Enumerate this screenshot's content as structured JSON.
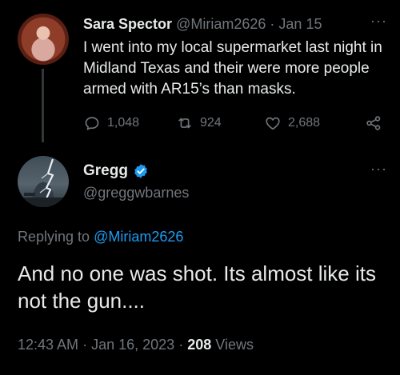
{
  "parent_tweet": {
    "name": "Sara Spector",
    "handle": "@Miriam2626",
    "separator": "·",
    "date": "Jan 15",
    "more": "···",
    "text": "I went into my local supermarket last night in Midland Texas and their were more people armed with AR15’s than masks.",
    "replies": "1,048",
    "retweets": "924",
    "likes": "2,688"
  },
  "main_tweet": {
    "name": "Gregg",
    "handle": "@greggwbarnes",
    "more": "···",
    "replying_prefix": "Replying to",
    "replying_mention": "@Miriam2626",
    "text": "And no one was shot. Its almost like its not the gun....",
    "time": "12:43 AM",
    "date": "Jan 16, 2023",
    "views_count": "208",
    "views_label": "Views"
  },
  "colors": {
    "background": "#000000",
    "text_primary": "#e7e9ea",
    "text_secondary": "#71767b",
    "accent": "#1d9bf0",
    "thread_line": "#333639"
  },
  "icons": [
    "reply-icon",
    "retweet-icon",
    "like-icon",
    "share-icon",
    "verified-badge-icon",
    "more-icon"
  ]
}
